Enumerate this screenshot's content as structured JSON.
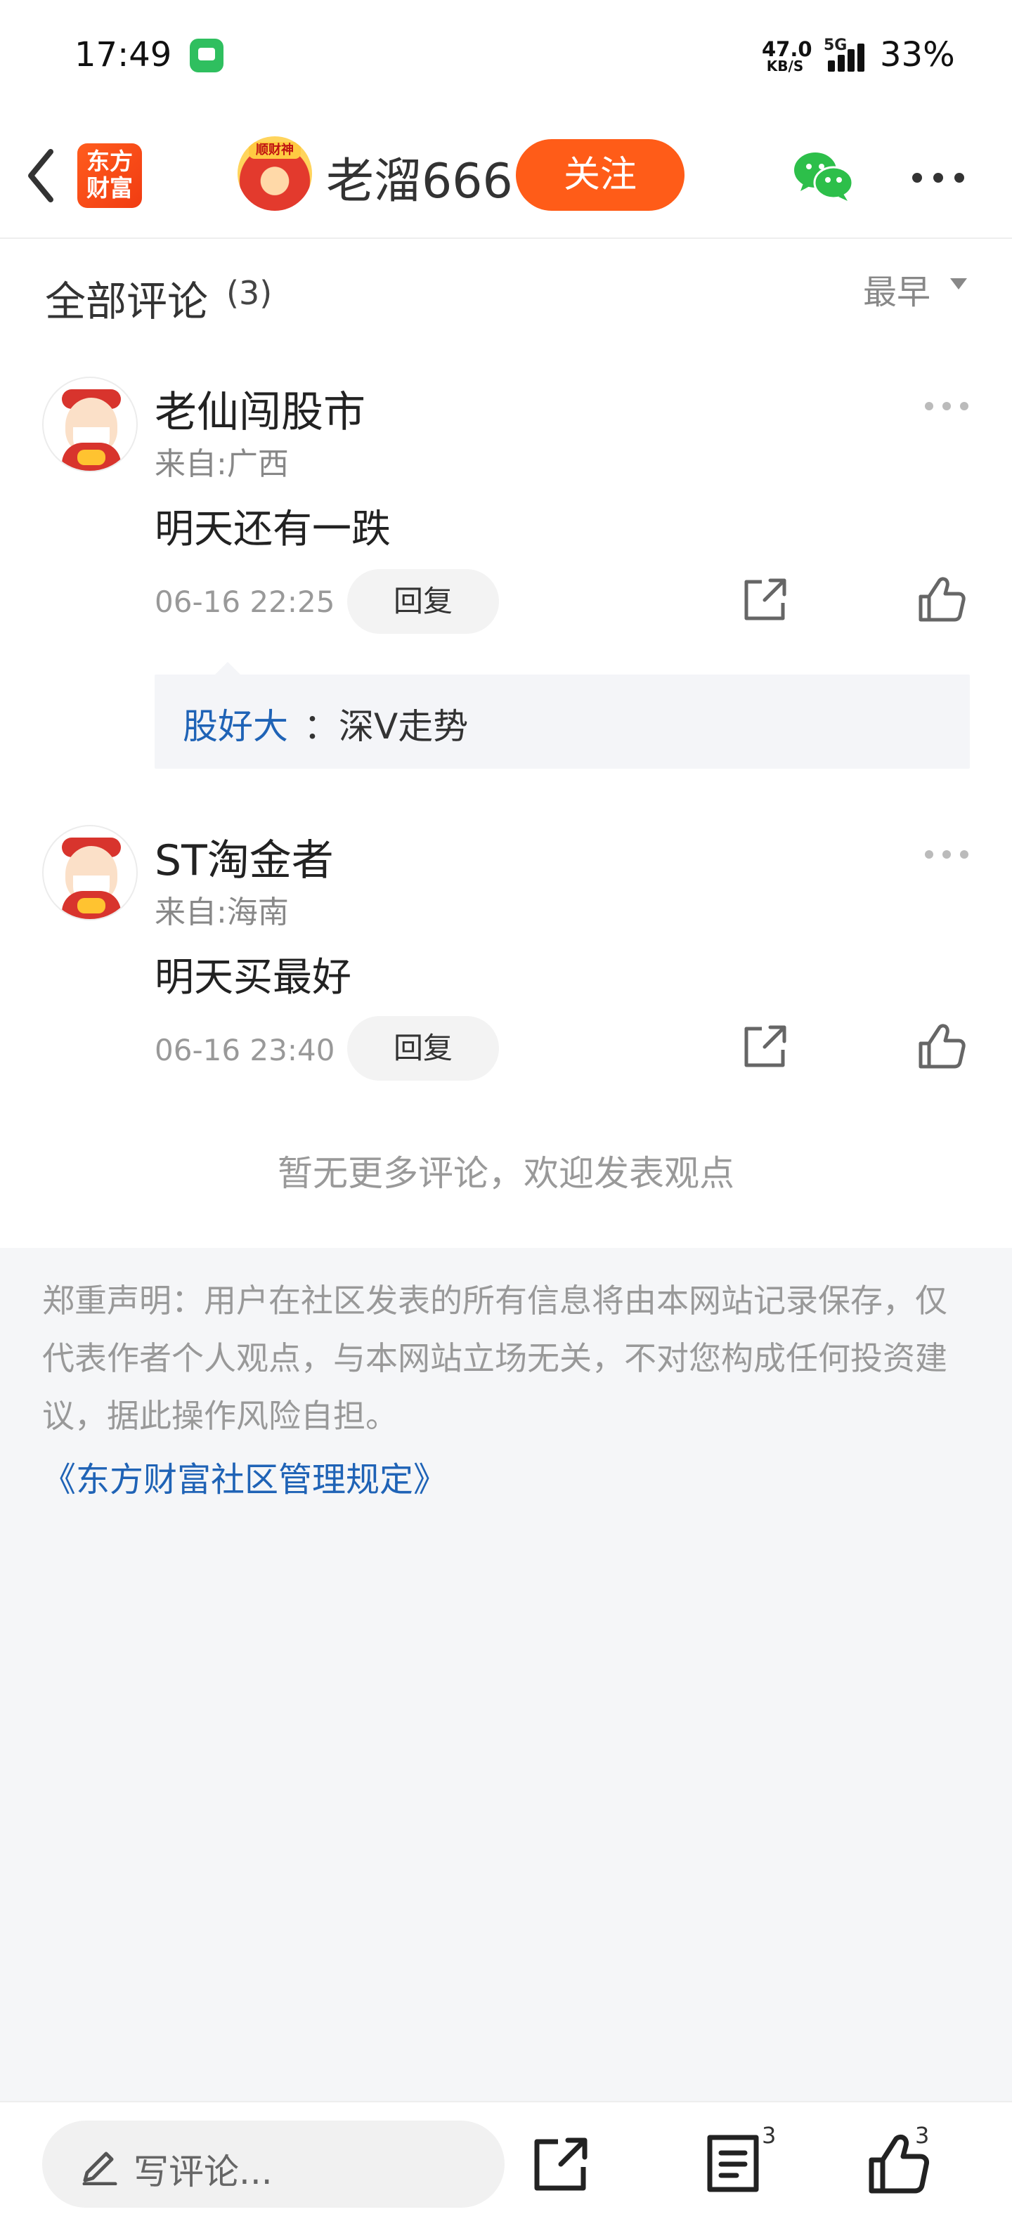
{
  "status_bar": {
    "time": "17:49",
    "network_speed": "47.0",
    "network_unit": "KB/S",
    "network_type": "5G",
    "battery": "33%"
  },
  "nav": {
    "logo_text_top": "东方",
    "logo_text_bottom": "财富",
    "avatar_banner": "顺财神",
    "author_name": "老溜666",
    "follow_label": "关注"
  },
  "comments": {
    "title": "全部评论",
    "count": "(3)",
    "sort_label": "最早",
    "items": [
      {
        "user": "老仙闯股市",
        "location": "来自:广西",
        "text": "明天还有一跌",
        "time": "06-16 22:25",
        "reply_label": "回复",
        "replies": [
          {
            "user": "股好大",
            "text": "：深V走势"
          }
        ]
      },
      {
        "user": "ST淘金者",
        "location": "来自:海南",
        "text": "明天买最好",
        "time": "06-16 23:40",
        "reply_label": "回复",
        "replies": []
      }
    ],
    "no_more_text": "暂无更多评论，欢迎发表观点"
  },
  "disclaimer": {
    "text": "郑重声明：用户在社区发表的所有信息将由本网站记录保存，仅代表作者个人观点，与本网站立场无关，不对您构成任何投资建议，据此操作风险自担。",
    "link": "《东方财富社区管理规定》"
  },
  "bottom_bar": {
    "comment_placeholder": "写评论...",
    "comment_count": "3",
    "like_count": "3"
  },
  "colors": {
    "brand_orange": "#ff5c18",
    "link_blue": "#1f63b6",
    "wechat_green": "#2dbf4a"
  },
  "icons": [
    "back-icon",
    "wechat-icon",
    "more-icon",
    "share-icon",
    "like-icon",
    "pencil-icon",
    "comment-icon"
  ]
}
